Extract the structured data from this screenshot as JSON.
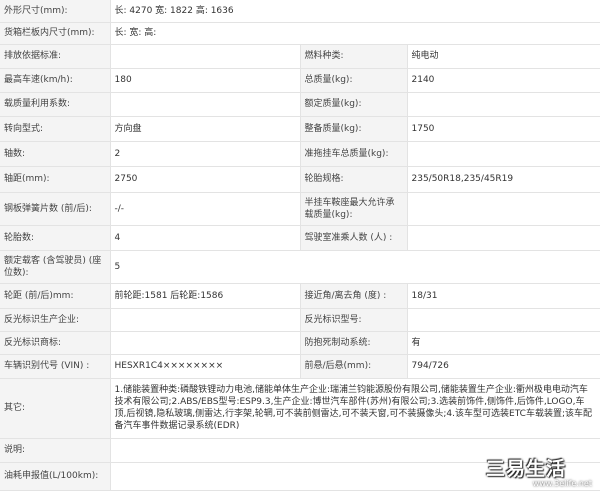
{
  "rows": [
    {
      "l1": "外形尺寸(mm):",
      "v1": "长: 4270 宽: 1822 高: 1636"
    },
    {
      "l1": "货箱栏板内尺寸(mm):",
      "v1": "长:  宽:  高:"
    },
    {
      "l1": "排放依据标准:",
      "v1": "",
      "l2": "燃料种类:",
      "v2": "纯电动"
    },
    {
      "l1": "最高车速(km/h):",
      "v1": "180",
      "l2": "总质量(kg):",
      "v2": "2140"
    },
    {
      "l1": "载质量利用系数:",
      "v1": "",
      "l2": "额定质量(kg):",
      "v2": ""
    },
    {
      "l1": "转向型式:",
      "v1": "方向盘",
      "l2": "整备质量(kg):",
      "v2": "1750"
    },
    {
      "l1": "轴数:",
      "v1": "2",
      "l2": "准拖挂车总质量(kg):",
      "v2": ""
    },
    {
      "l1": "轴距(mm):",
      "v1": "2750",
      "l2": "轮胎规格:",
      "v2": "235/50R18,235/45R19"
    },
    {
      "l1": "钢板弹簧片数 (前/后):",
      "v1": "-/-",
      "l2": "半挂车鞍座最大允许承载质量(kg):",
      "v2": ""
    },
    {
      "l1": "轮胎数:",
      "v1": "4",
      "l2": "驾驶室准乘人数 (人) :",
      "v2": ""
    },
    {
      "l1": "额定载客 (含驾驶员) (座位数):",
      "v1": "5"
    },
    {
      "l1": "轮距 (前/后)mm:",
      "v1": "前轮距:1581 后轮距:1586",
      "l2": "接近角/离去角 (度) :",
      "v2": "18/31"
    },
    {
      "l1": "反光标识生产企业:",
      "v1": "",
      "l2": "反光标识型号:",
      "v2": ""
    },
    {
      "l1": "反光标识商标:",
      "v1": "",
      "l2": "防抱死制动系统:",
      "v2": "有"
    },
    {
      "l1": "车辆识别代号 (VIN) :",
      "v1": "HESXR1C4××××××××",
      "l2": "前悬/后悬(mm):",
      "v2": "794/726"
    }
  ],
  "other": {
    "label": "其它:",
    "value": "1.储能装置种类:磷酸铁锂动力电池,储能单体生产企业:瑞浦兰钧能源股份有限公司,储能装置生产企业:衢州极电电动汽车技术有限公司;2.ABS/EBS型号:ESP9.3,生产企业:博世汽车部件(苏州)有限公司;3.选装前饰件,侧饰件,后饰件,LOGO,车顶,后视镜,隐私玻璃,侧雷达,行李架,轮辋,可不装前侧雷达,可不装天窗,可不装摄像头;4.该车型可选装ETC车载装置;该车配备汽车事件数据记录系统(EDR)"
  },
  "notes": {
    "label": "说明:",
    "value": ""
  },
  "fuel": {
    "label": "油耗申报值(L/100km):",
    "value": ""
  },
  "watermark": {
    "brand": "三易生活",
    "site": "www.3elife.net"
  }
}
